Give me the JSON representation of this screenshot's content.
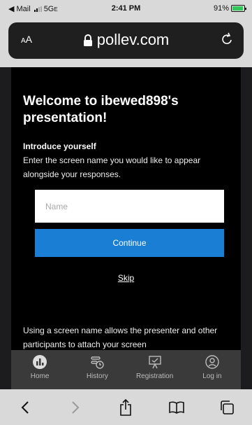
{
  "statusbar": {
    "back_app": "◀ Mail",
    "network": "5G",
    "network_suffix": "E",
    "time": "2:41 PM",
    "battery": "91%",
    "battery_level": 0.91
  },
  "addressbar": {
    "text_size_label": "AA",
    "url": "pollev.com"
  },
  "page": {
    "welcome": "Welcome to ibewed898's presentation!",
    "intro_title": "Introduce yourself",
    "intro_desc": "Enter the screen name you would like to appear alongside your responses.",
    "name_placeholder": "Name",
    "name_value": "",
    "continue_label": "Continue",
    "skip_label": "Skip",
    "footnote": "Using a screen name allows the presenter and other participants to attach your screen"
  },
  "app_nav": {
    "items": [
      {
        "label": "Home",
        "icon": "home-chart-icon"
      },
      {
        "label": "History",
        "icon": "history-icon"
      },
      {
        "label": "Registration",
        "icon": "registration-icon"
      },
      {
        "label": "Log in",
        "icon": "user-icon"
      }
    ]
  },
  "safari_toolbar": {
    "items": [
      "back-icon",
      "forward-icon",
      "share-icon",
      "bookmarks-icon",
      "tabs-icon"
    ]
  },
  "colors": {
    "accent": "#1a7fd4",
    "page_bg": "#000000",
    "nav_bg": "#3a3a3a",
    "browser_chrome": "#d9d9d9"
  }
}
